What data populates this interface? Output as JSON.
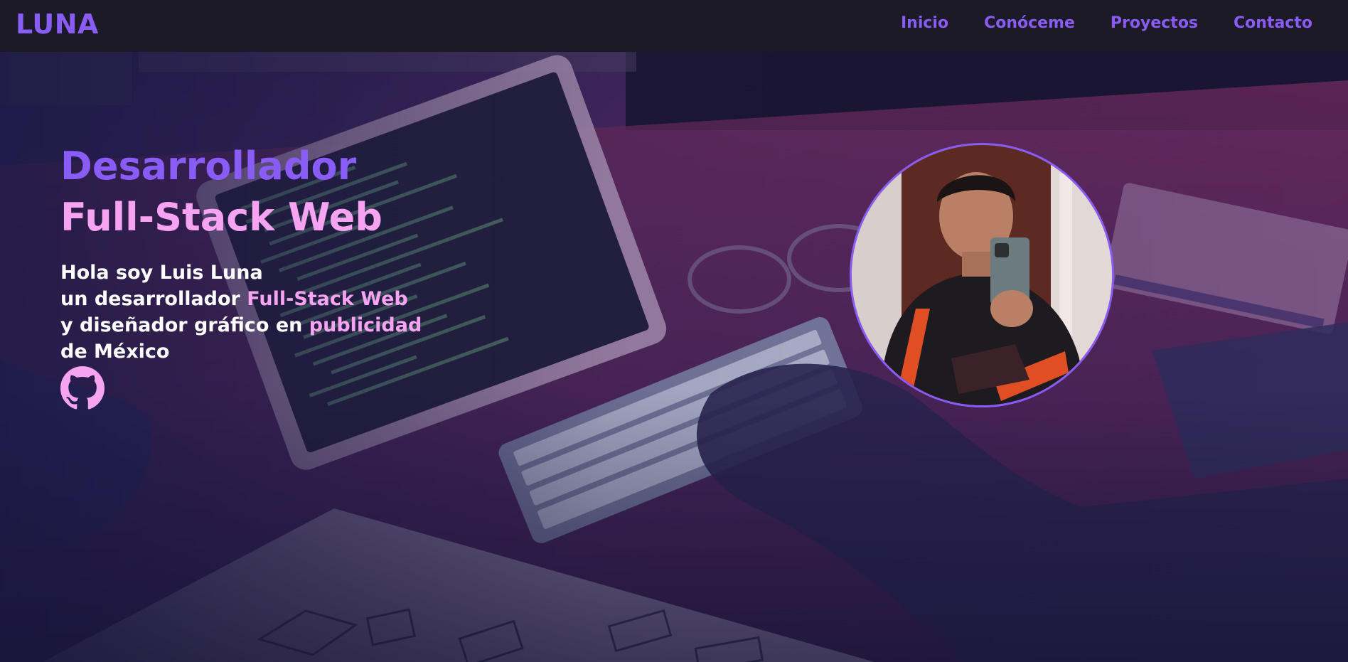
{
  "navbar": {
    "logo": "LUNA",
    "links": [
      {
        "label": "Inicio"
      },
      {
        "label": "Conóceme"
      },
      {
        "label": "Proyectos"
      },
      {
        "label": "Contacto"
      }
    ]
  },
  "hero": {
    "title_line1": "Desarrollador",
    "title_line2": "Full-Stack Web",
    "intro": {
      "line1": "Hola soy Luis Luna",
      "line2_prefix": "un desarrollador ",
      "line2_highlight": "Full-Stack Web",
      "line3_prefix": "y diseñador gráfico en ",
      "line3_highlight": "publicidad",
      "line4": "de México"
    },
    "social_icon": "github-icon"
  },
  "colors": {
    "accent": "#8a5cf6",
    "highlight": "#f6a3f2",
    "navbar_bg": "#1c1a26",
    "text": "#ffffff"
  }
}
